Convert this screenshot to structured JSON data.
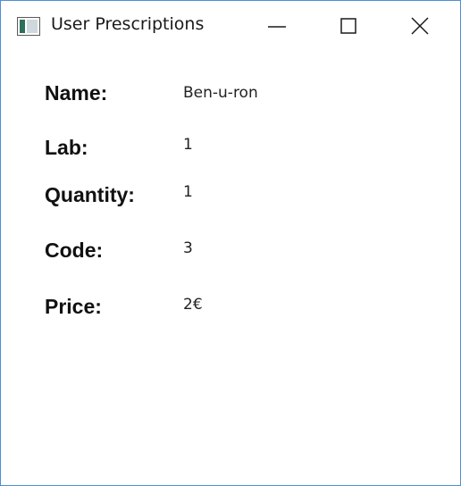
{
  "window": {
    "title": "User Prescriptions",
    "icon": "app-window-icon"
  },
  "controls": {
    "minimize_icon": "minimize-icon",
    "maximize_icon": "maximize-icon",
    "close_icon": "close-icon"
  },
  "fields": {
    "name": {
      "label": "Name:",
      "value": "Ben-u-ron"
    },
    "lab": {
      "label": "Lab:",
      "value": "1"
    },
    "quantity": {
      "label": "Quantity:",
      "value": "1"
    },
    "code": {
      "label": "Code:",
      "value": "3"
    },
    "price": {
      "label": "Price:",
      "value": "2€"
    }
  },
  "colors": {
    "window_border": "#4f8fd6",
    "background": "#ffffff",
    "text": "#111111"
  }
}
